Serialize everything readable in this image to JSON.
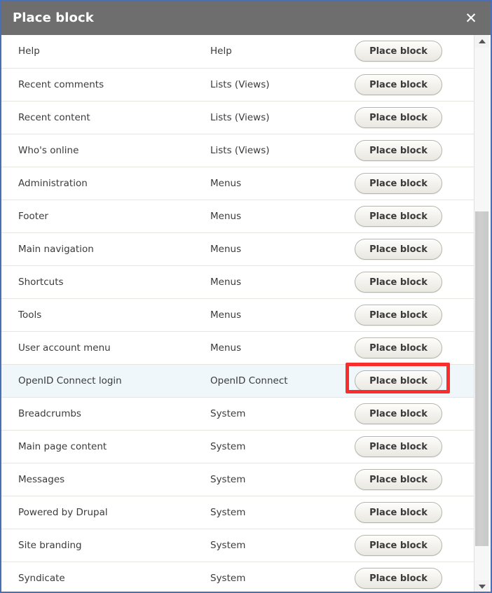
{
  "modal": {
    "title": "Place block",
    "close_label": "✕"
  },
  "table": {
    "rows": [
      {
        "label": "Help",
        "category": "Help",
        "action": "Place block",
        "highlighted": false,
        "annotated": false
      },
      {
        "label": "Recent comments",
        "category": "Lists (Views)",
        "action": "Place block",
        "highlighted": false,
        "annotated": false
      },
      {
        "label": "Recent content",
        "category": "Lists (Views)",
        "action": "Place block",
        "highlighted": false,
        "annotated": false
      },
      {
        "label": "Who's online",
        "category": "Lists (Views)",
        "action": "Place block",
        "highlighted": false,
        "annotated": false
      },
      {
        "label": "Administration",
        "category": "Menus",
        "action": "Place block",
        "highlighted": false,
        "annotated": false
      },
      {
        "label": "Footer",
        "category": "Menus",
        "action": "Place block",
        "highlighted": false,
        "annotated": false
      },
      {
        "label": "Main navigation",
        "category": "Menus",
        "action": "Place block",
        "highlighted": false,
        "annotated": false
      },
      {
        "label": "Shortcuts",
        "category": "Menus",
        "action": "Place block",
        "highlighted": false,
        "annotated": false
      },
      {
        "label": "Tools",
        "category": "Menus",
        "action": "Place block",
        "highlighted": false,
        "annotated": false
      },
      {
        "label": "User account menu",
        "category": "Menus",
        "action": "Place block",
        "highlighted": false,
        "annotated": false
      },
      {
        "label": "OpenID Connect login",
        "category": "OpenID Connect",
        "action": "Place block",
        "highlighted": true,
        "annotated": true
      },
      {
        "label": "Breadcrumbs",
        "category": "System",
        "action": "Place block",
        "highlighted": false,
        "annotated": false
      },
      {
        "label": "Main page content",
        "category": "System",
        "action": "Place block",
        "highlighted": false,
        "annotated": false
      },
      {
        "label": "Messages",
        "category": "System",
        "action": "Place block",
        "highlighted": false,
        "annotated": false
      },
      {
        "label": "Powered by Drupal",
        "category": "System",
        "action": "Place block",
        "highlighted": false,
        "annotated": false
      },
      {
        "label": "Site branding",
        "category": "System",
        "action": "Place block",
        "highlighted": false,
        "annotated": false
      },
      {
        "label": "Syndicate",
        "category": "System",
        "action": "Place block",
        "highlighted": false,
        "annotated": false
      }
    ]
  },
  "colors": {
    "header_bg": "#6e6e6e",
    "modal_border": "#4a6fb5",
    "row_highlight": "#eff7fb",
    "annotation": "#fa2d2d",
    "row_divider": "#e6e6e0"
  }
}
